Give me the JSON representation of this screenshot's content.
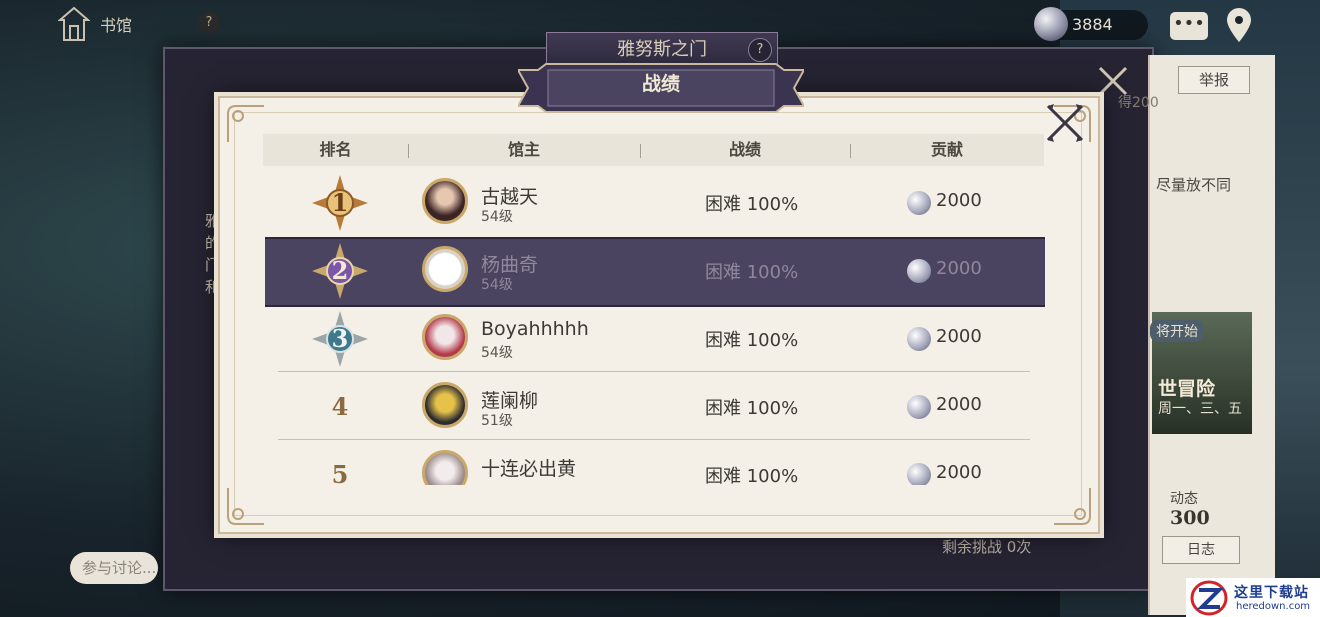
{
  "topbar": {
    "home_label": "书馆",
    "help_symbol": "?",
    "currency_value": "3884",
    "chat_icon": "chat-bubble-icon",
    "map_icon": "map-pin-icon"
  },
  "back_panel": {
    "title": "雅努斯之门",
    "help_symbol": "?",
    "left_text": "雅的门和",
    "discuss_placeholder": "参与讨论...",
    "remaining": "剩余挑战 0次"
  },
  "side": {
    "report": "举报",
    "partial_count": "得200",
    "text": "尽量放不同",
    "banner_tag": "将开始",
    "banner_title": "世冒险",
    "banner_sub": "周一、三、五",
    "dynamic_label": "动态",
    "dynamic_value": "300",
    "log": "日志"
  },
  "modal": {
    "title": "战绩",
    "columns": [
      "排名",
      "馆主",
      "战绩",
      "贡献"
    ],
    "rows": [
      {
        "rank": "1",
        "name": "古越天",
        "level": "54级",
        "score": "困难  100%",
        "contribution": "2000",
        "selected": false,
        "medal_color": "#b77a3a"
      },
      {
        "rank": "2",
        "name": "杨曲奇",
        "level": "54级",
        "score": "困难  100%",
        "contribution": "2000",
        "selected": true,
        "medal_color": "#7a55a8"
      },
      {
        "rank": "3",
        "name": "Boyahhhhh",
        "level": "54级",
        "score": "困难  100%",
        "contribution": "2000",
        "selected": false,
        "medal_color": "#3f7a8c"
      },
      {
        "rank": "4",
        "name": "莲阑柳",
        "level": "51级",
        "score": "困难  100%",
        "contribution": "2000",
        "selected": false,
        "medal_color": ""
      },
      {
        "rank": "5",
        "name": "十连必出黄",
        "level": "",
        "score": "困难  100%",
        "contribution": "2000",
        "selected": false,
        "medal_color": ""
      }
    ]
  },
  "watermark": {
    "cn": "这里下载站",
    "en": "heredown.com"
  },
  "colors": {
    "accent_gold": "#b9a27b",
    "selected_row": "#4a4460",
    "title_plate": "#3a3450"
  }
}
